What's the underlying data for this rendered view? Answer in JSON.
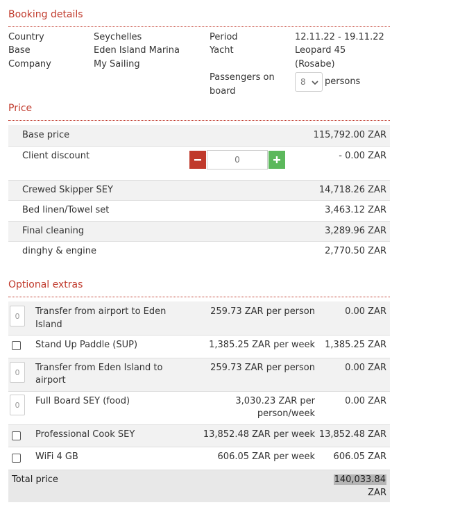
{
  "booking": {
    "title": "Booking details",
    "country_label": "Country",
    "country_value": "Seychelles",
    "base_label": "Base",
    "base_value": "Eden Island Marina",
    "company_label": "Company",
    "company_value": "My Sailing",
    "period_label": "Period",
    "period_value": "12.11.22 - 19.11.22",
    "yacht_label": "Yacht",
    "yacht_value_line1": "Leopard 45",
    "yacht_value_line2": "(Rosabe)",
    "passengers_label_line1": "Passengers on",
    "passengers_label_line2": "board",
    "passengers_value": "8",
    "passengers_unit": "persons"
  },
  "price": {
    "title": "Price",
    "base_price_label": "Base price",
    "base_price_value": "115,792.00 ZAR",
    "client_discount_label": "Client discount",
    "client_discount_input": "0",
    "client_discount_value": "- 0.00 ZAR",
    "items": [
      {
        "label": "Crewed Skipper SEY",
        "value": "14,718.26 ZAR"
      },
      {
        "label": "Bed linen/Towel set",
        "value": "3,463.12 ZAR"
      },
      {
        "label": "Final cleaning",
        "value": "3,289.96 ZAR"
      },
      {
        "label": "dinghy & engine",
        "value": "2,770.50 ZAR"
      }
    ]
  },
  "extras": {
    "title": "Optional extras",
    "items": [
      {
        "control": "qty",
        "qty": "0",
        "name_line1": "Transfer from airport to Eden",
        "name_line2": "Island",
        "rate_line1": "259.73 ZAR per person",
        "rate_line2": "",
        "total": "0.00 ZAR"
      },
      {
        "control": "checkbox",
        "name_line1": "Stand Up Paddle (SUP)",
        "name_line2": "",
        "rate_line1": "1,385.25 ZAR per week",
        "rate_line2": "",
        "total": "1,385.25 ZAR"
      },
      {
        "control": "qty",
        "qty": "0",
        "name_line1": "Transfer from Eden Island to",
        "name_line2": "airport",
        "rate_line1": "259.73 ZAR per person",
        "rate_line2": "",
        "total": "0.00 ZAR"
      },
      {
        "control": "qty",
        "qty": "0",
        "name_line1": "Full Board SEY (food)",
        "name_line2": "",
        "rate_line1": "3,030.23 ZAR per",
        "rate_line2": "person/week",
        "total": "0.00 ZAR"
      },
      {
        "control": "checkbox",
        "name_line1": "Professional Cook SEY",
        "name_line2": "",
        "rate_line1": "13,852.48 ZAR per week",
        "rate_line2": "",
        "total": "13,852.48 ZAR"
      },
      {
        "control": "checkbox",
        "name_line1": "WiFi 4 GB",
        "name_line2": "",
        "rate_line1": "606.05 ZAR per week",
        "rate_line2": "",
        "total": "606.05 ZAR"
      }
    ]
  },
  "total": {
    "label": "Total price",
    "value": "140,033.84",
    "currency": "ZAR"
  },
  "colors": {
    "accent": "#c0392b",
    "plus_button": "#5cb85c",
    "row_alt": "#f2f2f2",
    "total_bg": "#e8e8e8"
  },
  "icons": {
    "minus": "minus-icon",
    "plus": "plus-icon",
    "select_chevron": "chevron-down-icon"
  }
}
